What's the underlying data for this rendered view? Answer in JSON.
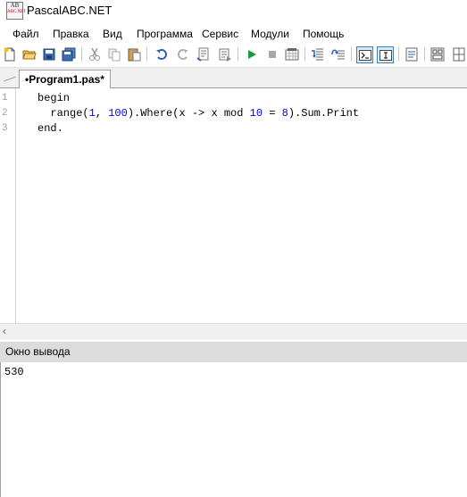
{
  "window": {
    "title": "PascalABC.NET",
    "icon_top": "AB",
    "icon_bottom": "ABC.NET"
  },
  "menu": [
    "Файл",
    "Правка",
    "Вид",
    "Программа",
    "Сервис",
    "Модули",
    "Помощь"
  ],
  "toolbar": {
    "buttons": [
      "new-file",
      "open",
      "save",
      "save-all",
      "cut",
      "copy",
      "paste",
      "undo",
      "redo",
      "build",
      "build-all",
      "run",
      "stop",
      "debug",
      "step-into",
      "step-over",
      "output-toggle",
      "immediate-toggle",
      "properties",
      "form-designer"
    ]
  },
  "editor": {
    "tab_label": "Program1.pas*",
    "tab_modified_mark": "•",
    "line_numbers": [
      "1",
      "2",
      "3"
    ],
    "lines": [
      "begin",
      "  range(1, 100).Where(x -> x mod 10 = 8).Sum.Print",
      "end."
    ]
  },
  "output": {
    "title": "Окно вывода",
    "text": "530"
  },
  "colors": {
    "keyword": "#000000",
    "number": "#0000ff",
    "active_button_border": "#3c7fb1"
  }
}
